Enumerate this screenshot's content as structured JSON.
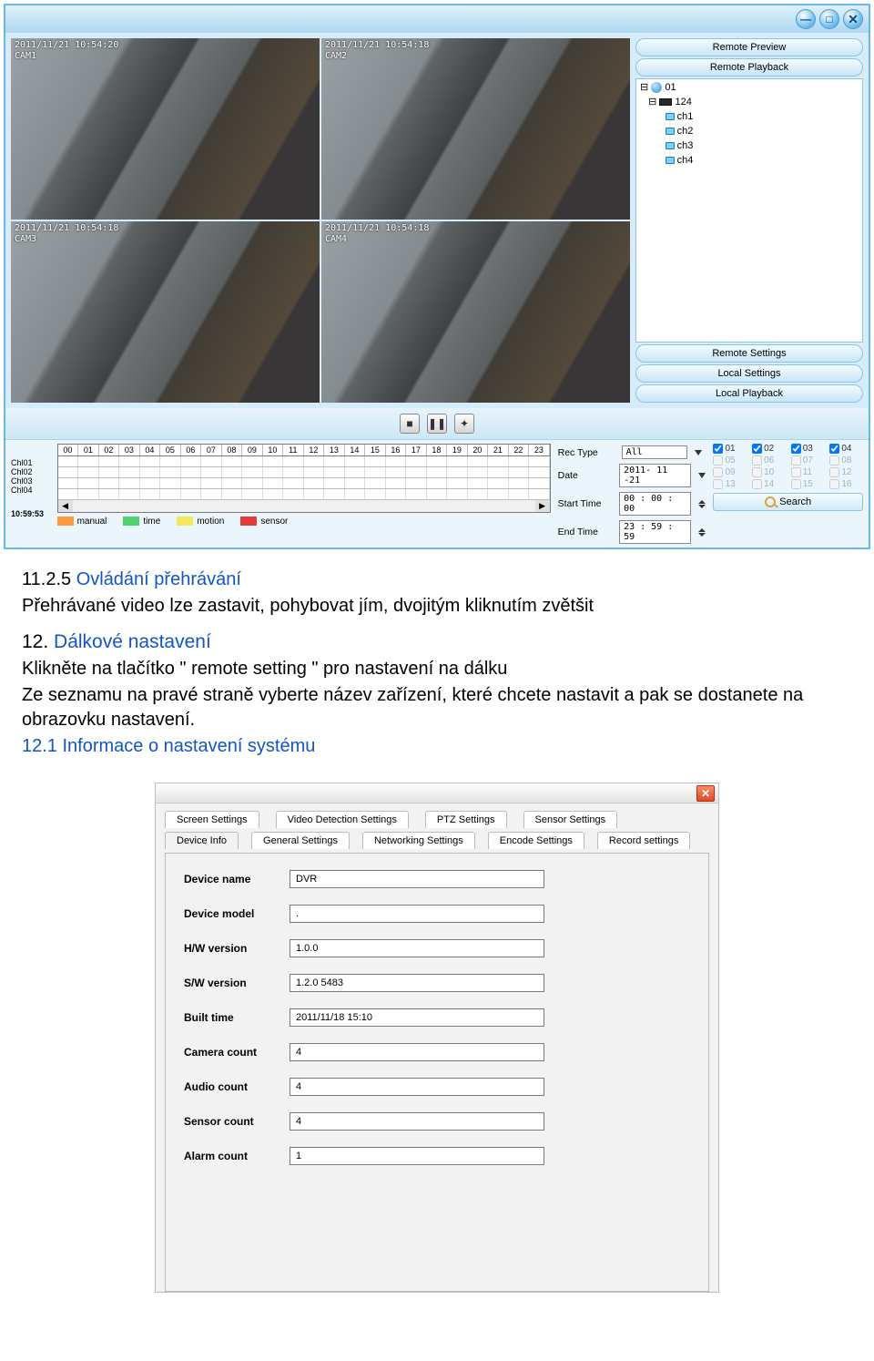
{
  "app": {
    "window_buttons": {
      "min": "—",
      "max": "□",
      "close": "✕"
    },
    "side": {
      "top": [
        "Remote Preview",
        "Remote Playback"
      ],
      "tree": {
        "root": "01",
        "device": "124",
        "channels": [
          "ch1",
          "ch2",
          "ch3",
          "ch4"
        ]
      },
      "bottom": [
        "Remote Settings",
        "Local Settings",
        "Local Playback"
      ]
    },
    "cams": [
      {
        "ts": "2011/11/21 10:54:20",
        "name": "CAM1"
      },
      {
        "ts": "2011/11/21 10:54:18",
        "name": "CAM2"
      },
      {
        "ts": "2011/11/21 10:54:18",
        "name": "CAM3"
      },
      {
        "ts": "2011/11/21 10:54:18",
        "name": "CAM4"
      }
    ],
    "controls": {
      "stop": "■",
      "pause": "❚❚",
      "capture": "✦"
    },
    "timeline": {
      "hours": [
        "00",
        "01",
        "02",
        "03",
        "04",
        "05",
        "06",
        "07",
        "08",
        "09",
        "10",
        "11",
        "12",
        "13",
        "14",
        "15",
        "16",
        "17",
        "18",
        "19",
        "20",
        "21",
        "22",
        "23"
      ],
      "channels": [
        "Chl01",
        "Chl02",
        "Chl03",
        "Chl04"
      ],
      "clock": "10:59:53",
      "legend": [
        {
          "color": "#ff9a3c",
          "label": "manual"
        },
        {
          "color": "#4fd16b",
          "label": "time"
        },
        {
          "color": "#f5e85b",
          "label": "motion"
        },
        {
          "color": "#e23b3b",
          "label": "sensor"
        }
      ]
    },
    "params": {
      "rec_type_label": "Rec Type",
      "rec_type_value": "All",
      "date_label": "Date",
      "date_value": "2011- 11 -21",
      "start_label": "Start Time",
      "start_value": "00 : 00 : 00",
      "end_label": "End Time",
      "end_value": "23 : 59 : 59"
    },
    "ch_select": {
      "row1": [
        {
          "n": "01",
          "on": true
        },
        {
          "n": "02",
          "on": true
        },
        {
          "n": "03",
          "on": true
        },
        {
          "n": "04",
          "on": true
        }
      ],
      "disabled_rows": [
        [
          "05",
          "06",
          "07",
          "08"
        ],
        [
          "09",
          "10",
          "11",
          "12"
        ],
        [
          "13",
          "14",
          "15",
          "16"
        ]
      ],
      "search": "Search"
    }
  },
  "doc": {
    "s1_num": "11.2.5 ",
    "s1_title": "Ovládání přehrávání",
    "s1_body": "Přehrávané video lze zastavit, pohybovat jím, dvojitým kliknutím zvětšit",
    "s2_num": "12. ",
    "s2_title": "Dálkové nastavení",
    "s2_body1": "Klikněte na tlačítko \" remote setting \" pro nastavení na dálku",
    "s2_body2": "Ze seznamu na pravé straně vyberte název zařízení, které chcete nastavit a pak se dostanete na obrazovku nastavení.",
    "s3": "  12.1 Informace o nastavení systému"
  },
  "dlg": {
    "tabs_top": [
      "Screen Settings",
      "Video Detection Settings",
      "PTZ Settings",
      "Sensor Settings"
    ],
    "tabs_bot": [
      "Device Info",
      "General Settings",
      "Networking Settings",
      "Encode Settings",
      "Record settings"
    ],
    "active_tab": "Device Info",
    "fields": [
      {
        "label": "Device name",
        "value": "DVR"
      },
      {
        "label": "Device model",
        "value": "."
      },
      {
        "label": "H/W version",
        "value": "1.0.0"
      },
      {
        "label": "S/W version",
        "value": "1.2.0 5483"
      },
      {
        "label": "Built time",
        "value": "2011/11/18 15:10"
      },
      {
        "label": "Camera count",
        "value": "4"
      },
      {
        "label": "Audio count",
        "value": "4"
      },
      {
        "label": "Sensor count",
        "value": "4"
      },
      {
        "label": "Alarm count",
        "value": "1"
      }
    ]
  }
}
